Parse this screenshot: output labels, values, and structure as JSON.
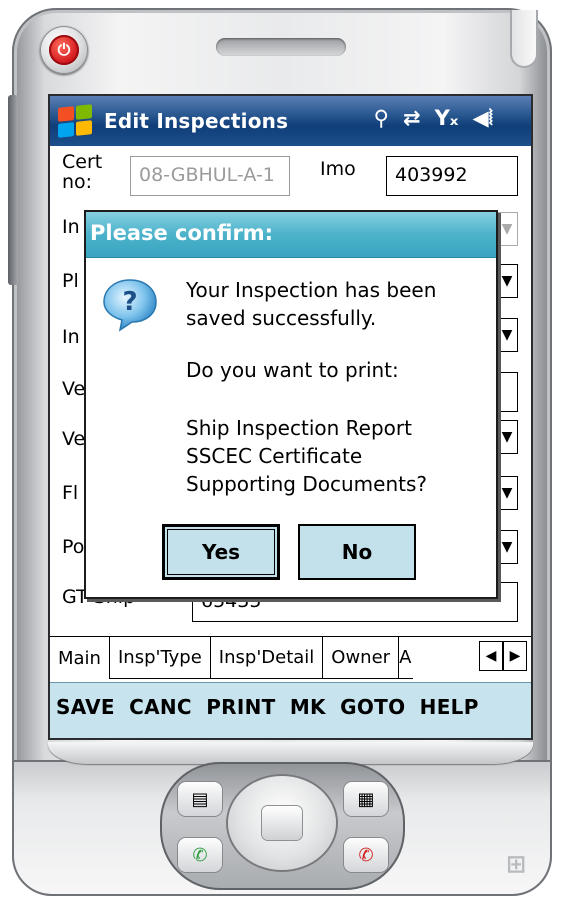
{
  "window": {
    "title": "Edit Inspections",
    "status_icons": [
      "connectivity-icon",
      "sync-arrows-icon",
      "no-signal-icon",
      "speaker-icon"
    ]
  },
  "form": {
    "cert_label": "Cert\nno:",
    "cert_value": "08-GBHUL-A-1",
    "imo_label": "Imo",
    "imo_value": "403992",
    "gt_ship_label": "GT Ship",
    "gt_ship_value": "65435",
    "hidden_row_labels": [
      "In",
      "Pl",
      "In",
      "Ve",
      "Ve",
      "Fl",
      "Po"
    ]
  },
  "dialog": {
    "title": "Please confirm:",
    "message_line1": "Your Inspection has been",
    "message_line2": "saved successfully.",
    "question": "Do you want to print:",
    "items_line1": "Ship Inspection Report",
    "items_line2": "SSCEC Certificate",
    "items_line3": "Supporting Documents?",
    "yes_label": "Yes",
    "no_label": "No"
  },
  "tabs": [
    {
      "label": "Main",
      "active": true
    },
    {
      "label": "Insp'Type",
      "active": false
    },
    {
      "label": "Insp'Detail",
      "active": false
    },
    {
      "label": "Owner",
      "active": false
    },
    {
      "label": "A",
      "active": false
    }
  ],
  "menu": [
    "SAVE",
    "CANC",
    "PRINT",
    "MK",
    "GOTO",
    "HELP"
  ],
  "colors": {
    "titlebar": "#1d4f8c",
    "dialog_title": "#4bb2ca",
    "dialog_button": "#c3e1ea",
    "menubar": "#c7e4ee",
    "power": "#d0141a"
  }
}
